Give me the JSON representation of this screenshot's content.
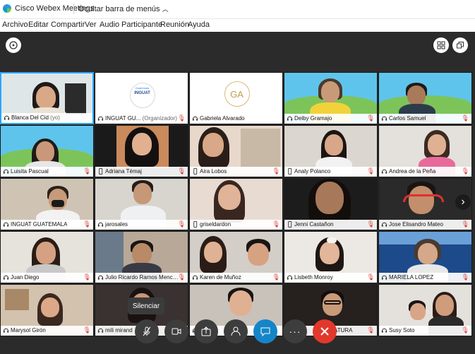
{
  "app": {
    "title": "Cisco Webex Meetings",
    "hide_menu": "Ocultar barra de menús",
    "brand_color": "#1ba1e2"
  },
  "menu": [
    "Archivo",
    "Editar",
    "Compartir",
    "Ver",
    "Audio",
    "Participante",
    "Reunión",
    "Ayuda"
  ],
  "tooltip": "Silenciar",
  "icons": {
    "info": "info-icon",
    "layout": "grid-layout-icon",
    "exit_fullscreen": "exit-fullscreen-icon",
    "next": "chevron-right-icon"
  },
  "participants": [
    {
      "name": "Blanca Del Cid",
      "suffix": "(yo)",
      "device": "phone"
    },
    {
      "name": "INGUAT GU...",
      "suffix": "(Organizador)",
      "device": "phone",
      "logo_top": "Guatemala",
      "logo_text": "INGUAT"
    },
    {
      "name": "Gabriela Alvarado",
      "suffix": "",
      "device": "phone",
      "initials": "GA"
    },
    {
      "name": "Deiby Gramajo",
      "suffix": "",
      "device": "phone"
    },
    {
      "name": "Carlos Samuel",
      "suffix": "",
      "device": "phone"
    },
    {
      "name": "Luisita Pascual",
      "suffix": "",
      "device": "phone"
    },
    {
      "name": "Adriana Témaj",
      "suffix": "",
      "device": "mobile"
    },
    {
      "name": "Aira Lobos",
      "suffix": "",
      "device": "mobile"
    },
    {
      "name": "Analy Polanco",
      "suffix": "",
      "device": "mobile"
    },
    {
      "name": "Andrea de la Peña",
      "suffix": "",
      "device": "phone"
    },
    {
      "name": "INGUAT GUATEMALA",
      "suffix": "",
      "device": "phone"
    },
    {
      "name": "jarosales",
      "suffix": "",
      "device": "phone"
    },
    {
      "name": "griseldardon",
      "suffix": "",
      "device": "mobile"
    },
    {
      "name": "Jenni Castañon",
      "suffix": "",
      "device": "mobile"
    },
    {
      "name": "Jose Elisandro Mateo",
      "suffix": "",
      "device": "phone"
    },
    {
      "name": "Juan Diego",
      "suffix": "",
      "device": "phone"
    },
    {
      "name": "Julio Ricardo Ramos Mencos",
      "suffix": "",
      "device": "phone"
    },
    {
      "name": "Karen de Muñoz",
      "suffix": "",
      "device": "phone"
    },
    {
      "name": "Lisbeth Monroy",
      "suffix": "",
      "device": "phone"
    },
    {
      "name": "MARIELA LOPEZ",
      "suffix": "",
      "device": "phone"
    },
    {
      "name": "Marysol Girón",
      "suffix": "",
      "device": "phone"
    },
    {
      "name": "mili mirand",
      "suffix": "",
      "device": "phone"
    },
    {
      "name": "",
      "suffix": "",
      "device": "phone"
    },
    {
      "name": "ATURA",
      "suffix": "",
      "device": "phone"
    },
    {
      "name": "Susy Soto",
      "suffix": "",
      "device": "phone"
    }
  ]
}
